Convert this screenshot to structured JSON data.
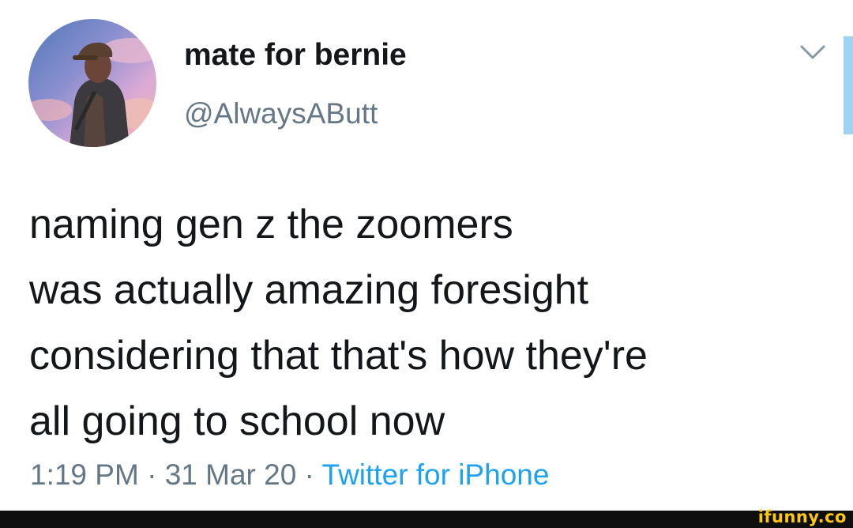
{
  "tweet": {
    "display_name": "mate for bernie",
    "handle": "@AlwaysAButt",
    "text_lines": [
      "naming gen z the zoomers",
      "was actually amazing foresight",
      "considering that that's how they're",
      "all going to school now"
    ],
    "time": "1:19 PM",
    "separator": "·",
    "date": "31 Mar 20",
    "source": "Twitter for iPhone",
    "avatar_icon": "profile-photo",
    "menu_icon": "chevron-down-icon"
  },
  "watermark": {
    "text": "ifunny.co"
  },
  "colors": {
    "text": "#14171a",
    "secondary": "#657786",
    "link": "#1da1f2",
    "watermark": "#ffc80a",
    "footer": "#0f0f0f"
  }
}
